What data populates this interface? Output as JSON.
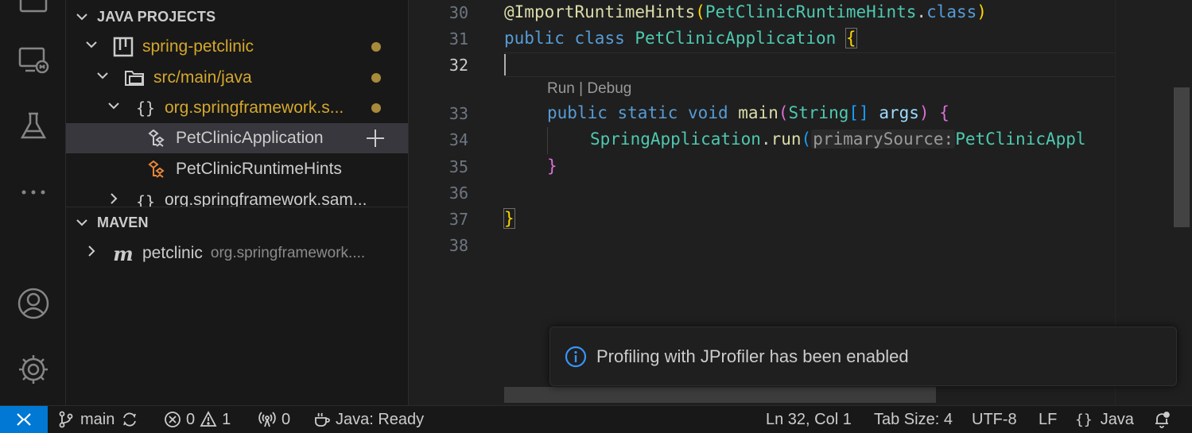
{
  "sidebar": {
    "java_projects_title": "JAVA PROJECTS",
    "tree": [
      {
        "label": "spring-petclinic"
      },
      {
        "label": "src/main/java"
      },
      {
        "label": "org.springframework.s..."
      },
      {
        "label": "PetClinicApplication"
      },
      {
        "label": "PetClinicRuntimeHints"
      },
      {
        "label": "org.springframework.sam..."
      }
    ],
    "maven_title": "MAVEN",
    "maven_item": {
      "label": "petclinic",
      "description": "org.springframework...."
    }
  },
  "editor": {
    "line_numbers": [
      "30",
      "31",
      "32",
      "33",
      "34",
      "35",
      "36",
      "37",
      "38"
    ],
    "codelens": "Run | Debug",
    "code": {
      "l30_at": "@",
      "l30_anno": "ImportRuntimeHints",
      "l30_p1": "(",
      "l30_cls": "PetClinicRuntimeHints",
      "l30_dot": ".",
      "l30_kw": "class",
      "l30_p2": ")",
      "l31_kw1": "public",
      "l31_kw2": "class",
      "l31_cls": "PetClinicApplication",
      "l31_brace": "{",
      "l33_kw1": "public",
      "l33_kw2": "static",
      "l33_kw3": "void",
      "l33_fn": "main",
      "l33_p1": "(",
      "l33_type": "String",
      "l33_arr": "[]",
      "l33_var": "args",
      "l33_p2": ")",
      "l33_brace": "{",
      "l34_cls": "SpringApplication",
      "l34_dot": ".",
      "l34_fn": "run",
      "l34_p1": "(",
      "l34_hint": "primarySource:",
      "l34_arg": "PetClinicAppl",
      "l35_brace": "}",
      "l37_brace": "}"
    }
  },
  "notification": {
    "message": "Profiling with JProfiler has been enabled"
  },
  "statusbar": {
    "branch": "main",
    "errors": "0",
    "warnings": "1",
    "ports": "0",
    "java_status": "Java: Ready",
    "position": "Ln 32, Col 1",
    "tab_size": "Tab Size: 4",
    "encoding": "UTF-8",
    "eol": "LF",
    "language": "Java"
  },
  "colors": {
    "accent": "#0078d4",
    "modified": "#a88a3a",
    "folder_label": "#d4a72c"
  }
}
